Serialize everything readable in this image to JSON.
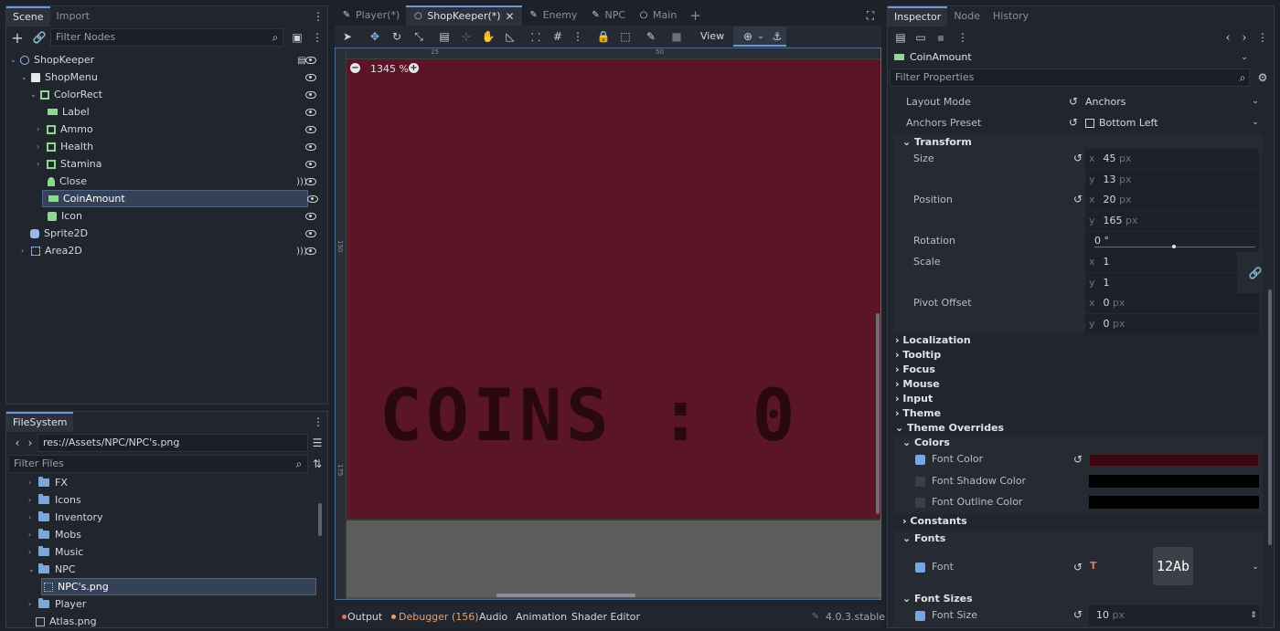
{
  "scene_panel": {
    "tabs": [
      "Scene",
      "Import"
    ],
    "filter_placeholder": "Filter Nodes",
    "tree": [
      {
        "label": "ShopKeeper",
        "icon": "node2d-icon"
      },
      {
        "label": "ShopMenu",
        "icon": "canvaslayer-icon"
      },
      {
        "label": "ColorRect",
        "icon": "colorrect-icon"
      },
      {
        "label": "Label",
        "icon": "label-icon"
      },
      {
        "label": "Ammo",
        "icon": "colorrect-icon"
      },
      {
        "label": "Health",
        "icon": "colorrect-icon"
      },
      {
        "label": "Stamina",
        "icon": "colorrect-icon"
      },
      {
        "label": "Close",
        "icon": "button-icon"
      },
      {
        "label": "CoinAmount",
        "icon": "label-icon"
      },
      {
        "label": "Icon",
        "icon": "texturerect-icon"
      },
      {
        "label": "Sprite2D",
        "icon": "sprite2d-icon"
      },
      {
        "label": "Area2D",
        "icon": "area2d-icon"
      }
    ]
  },
  "filesystem": {
    "title": "FileSystem",
    "path": "res://Assets/NPC/NPC's.png",
    "filter_placeholder": "Filter Files",
    "items": [
      "FX",
      "Icons",
      "Inventory",
      "Mobs",
      "Music",
      "NPC",
      "NPC's.png",
      "Player",
      "Atlas.png"
    ]
  },
  "editor": {
    "tabs": [
      "Player(*)",
      "ShopKeeper(*)",
      "Enemy",
      "NPC",
      "Main"
    ],
    "zoom": "1345 %",
    "view_label": "View",
    "ruler_marks": [
      "25",
      "50",
      "150",
      "175"
    ],
    "canvas_text": "COINS : 0",
    "canvas_color": "#5a1526",
    "bottom_tabs": [
      "Output",
      "Debugger (156)",
      "Audio",
      "Animation",
      "Shader Editor"
    ],
    "version": "4.0.3.stable"
  },
  "inspector": {
    "tabs": [
      "Inspector",
      "Node",
      "History"
    ],
    "node_name": "CoinAmount",
    "filter_placeholder": "Filter Properties",
    "layout_mode_label": "Layout Mode",
    "layout_mode_value": "Anchors",
    "anchors_preset_label": "Anchors Preset",
    "anchors_preset_value": "Bottom Left",
    "transform_label": "Transform",
    "size_label": "Size",
    "size_x": "45",
    "size_y": "13",
    "position_label": "Position",
    "pos_x": "20",
    "pos_y": "165",
    "rotation_label": "Rotation",
    "rotation_value": "0 °",
    "scale_label": "Scale",
    "scale_x": "1",
    "scale_y": "1",
    "pivot_label": "Pivot Offset",
    "pivot_x": "0",
    "pivot_y": "0",
    "unit_px": "px",
    "axis_x": "x",
    "axis_y": "y",
    "sections": [
      "Localization",
      "Tooltip",
      "Focus",
      "Mouse",
      "Input",
      "Theme",
      "Theme Overrides"
    ],
    "colors_label": "Colors",
    "font_color_label": "Font Color",
    "font_color": "#3b0710",
    "font_shadow_label": "Font Shadow Color",
    "font_outline_label": "Font Outline Color",
    "constants_label": "Constants",
    "fonts_label": "Fonts",
    "font_label": "Font",
    "font_preview": "12Ab",
    "font_sizes_label": "Font Sizes",
    "font_size_label": "Font Size",
    "font_size_value": "10"
  }
}
